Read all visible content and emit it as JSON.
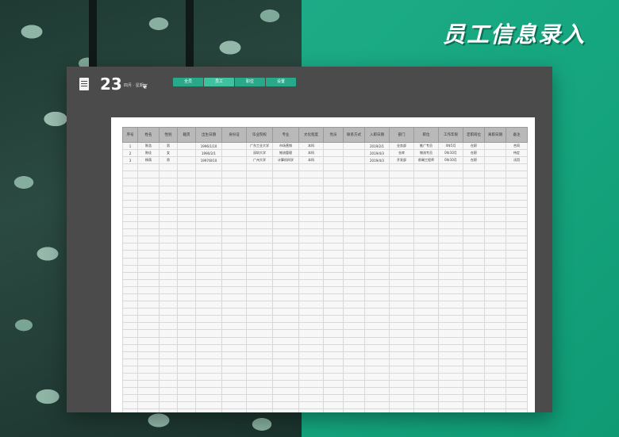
{
  "banner": {
    "title": "员工信息录入"
  },
  "header": {
    "day": "23",
    "date_info": "四月 · 星期一",
    "weather_icon": "leaf-icon",
    "tabs": [
      {
        "label": "全员"
      },
      {
        "label": "员工"
      },
      {
        "label": "职位"
      },
      {
        "label": "设置"
      }
    ],
    "active_tab": 1
  },
  "table": {
    "columns": [
      "序号",
      "姓名",
      "性别",
      "籍贯",
      "出生日期",
      "身份证",
      "毕业院校",
      "专业",
      "文化程度",
      "党员",
      "联系方式",
      "入职日期",
      "部门",
      "职位",
      "工作年限",
      "定职岗位",
      "离职日期",
      "备注"
    ],
    "rows": [
      [
        "1",
        "陈浩",
        "男",
        "",
        "1996/1/10",
        "",
        "广东工业大学",
        "市场营销",
        "本科",
        "",
        "",
        "2019/2/1",
        "业务部",
        "推广专员",
        "4年5月",
        "在职",
        "",
        "合同"
      ],
      [
        "2",
        "陈佳",
        "女",
        "",
        "1990/2/1",
        "",
        "深圳大学",
        "物流管理",
        "本科",
        "",
        "",
        "2019/4/3",
        "仓库",
        "物流专员",
        "0年10月",
        "在职",
        "",
        "待定"
      ],
      [
        "3",
        "杨萌",
        "男",
        "",
        "1997/8/10",
        "",
        "广州大学",
        "计算机科学",
        "本科",
        "",
        "",
        "2019/4/3",
        "开发部",
        "前端工程师",
        "0年10月",
        "在职",
        "",
        "试用"
      ]
    ],
    "empty_rows": 39
  }
}
